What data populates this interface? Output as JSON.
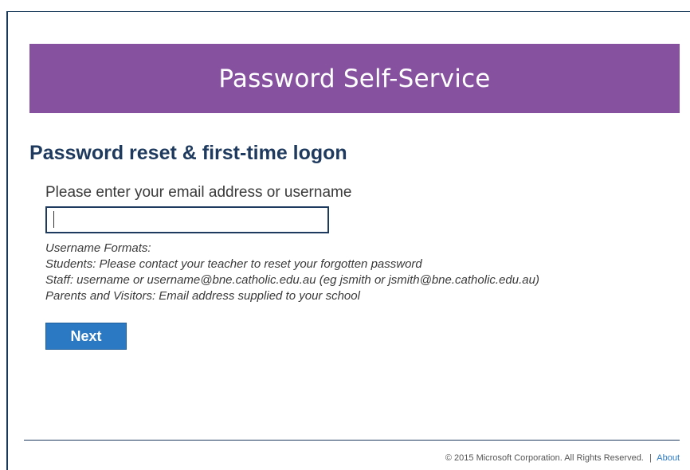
{
  "banner": {
    "title": "Password Self-Service"
  },
  "main": {
    "heading": "Password reset & first-time logon",
    "prompt": "Please enter your email address or username",
    "input_value": "",
    "hints": [
      "Username Formats:",
      "Students: Please contact your teacher to reset your forgotten password",
      "Staff: username or username@bne.catholic.edu.au (eg jsmith or jsmith@bne.catholic.edu.au)",
      "Parents and Visitors: Email address supplied to your school"
    ],
    "next_label": "Next"
  },
  "footer": {
    "copyright": "© 2015 Microsoft Corporation. All Rights Reserved.",
    "separator": "|",
    "about_label": "About"
  },
  "colors": {
    "banner": "#8652a0",
    "heading": "#1e3a5e",
    "button": "#2b79c2"
  }
}
